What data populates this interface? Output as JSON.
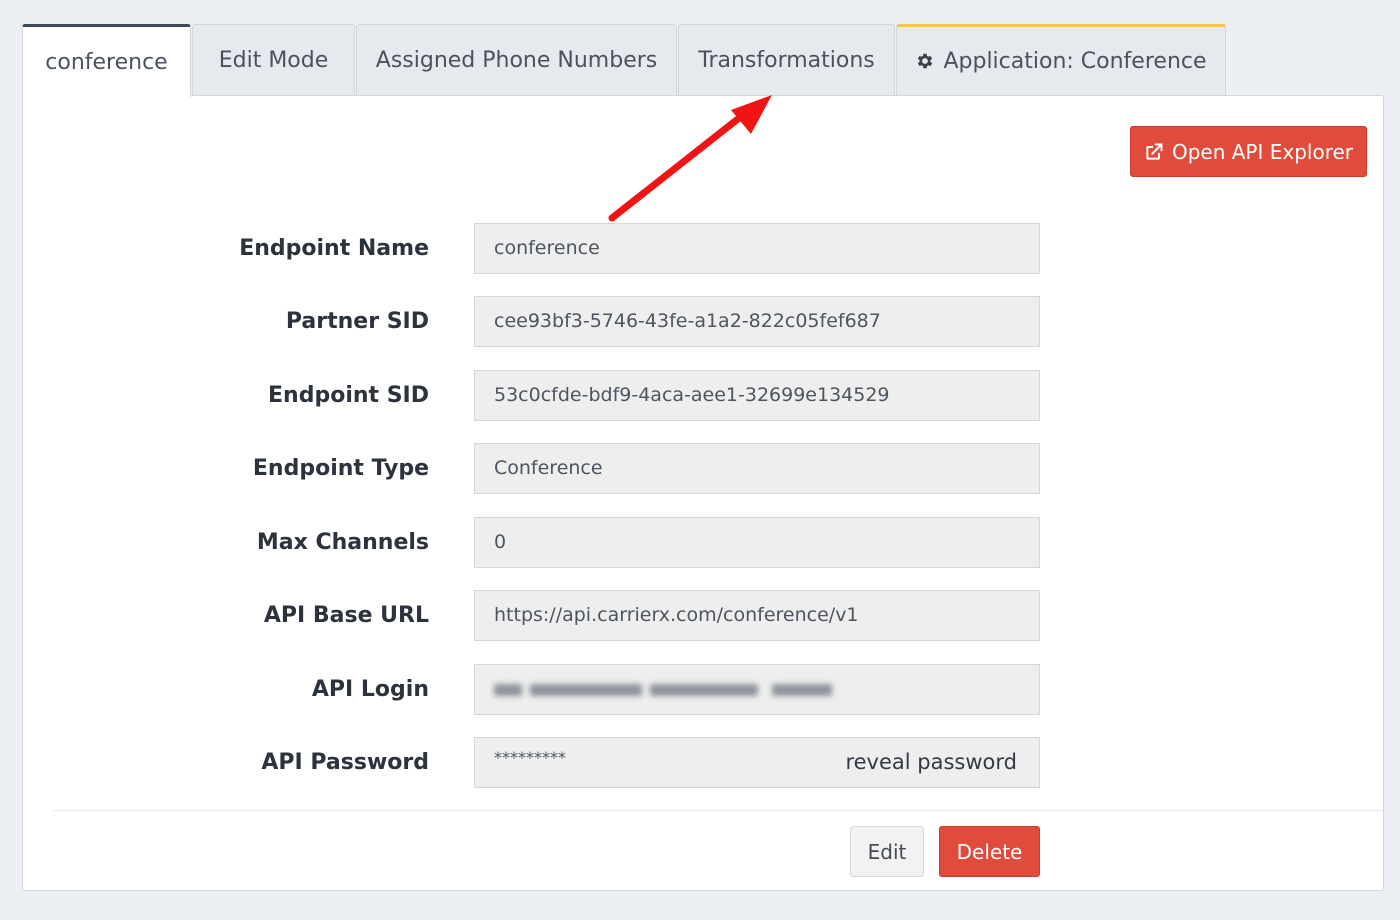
{
  "tabs": [
    {
      "label": "conference",
      "active": true
    },
    {
      "label": "Edit Mode"
    },
    {
      "label": "Assigned Phone Numbers"
    },
    {
      "label": "Transformations"
    },
    {
      "label": "Application: Conference",
      "icon": "gear-icon"
    }
  ],
  "toolbar": {
    "api_explorer_label": "Open API Explorer",
    "api_explorer_icon": "external-link-icon"
  },
  "fields": {
    "endpoint_name": {
      "label": "Endpoint Name",
      "value": "conference"
    },
    "partner_sid": {
      "label": "Partner SID",
      "value": "cee93bf3-5746-43fe-a1a2-822c05fef687"
    },
    "endpoint_sid": {
      "label": "Endpoint SID",
      "value": "53c0cfde-bdf9-4aca-aee1-32699e134529"
    },
    "endpoint_type": {
      "label": "Endpoint Type",
      "value": "Conference"
    },
    "max_channels": {
      "label": "Max Channels",
      "value": "0"
    },
    "api_base_url": {
      "label": "API Base URL",
      "value": "https://api.carrierx.com/conference/v1"
    },
    "api_login": {
      "label": "API Login"
    },
    "api_password": {
      "label": "API Password",
      "value": "*********",
      "reveal_label": "reveal password"
    }
  },
  "actions": {
    "edit_label": "Edit",
    "delete_label": "Delete"
  },
  "colors": {
    "accent_red": "#e04b3b",
    "annotation_arrow": "#f01414",
    "app_tab_top": "#f5c842",
    "active_tab_top": "#3c4a5a"
  }
}
